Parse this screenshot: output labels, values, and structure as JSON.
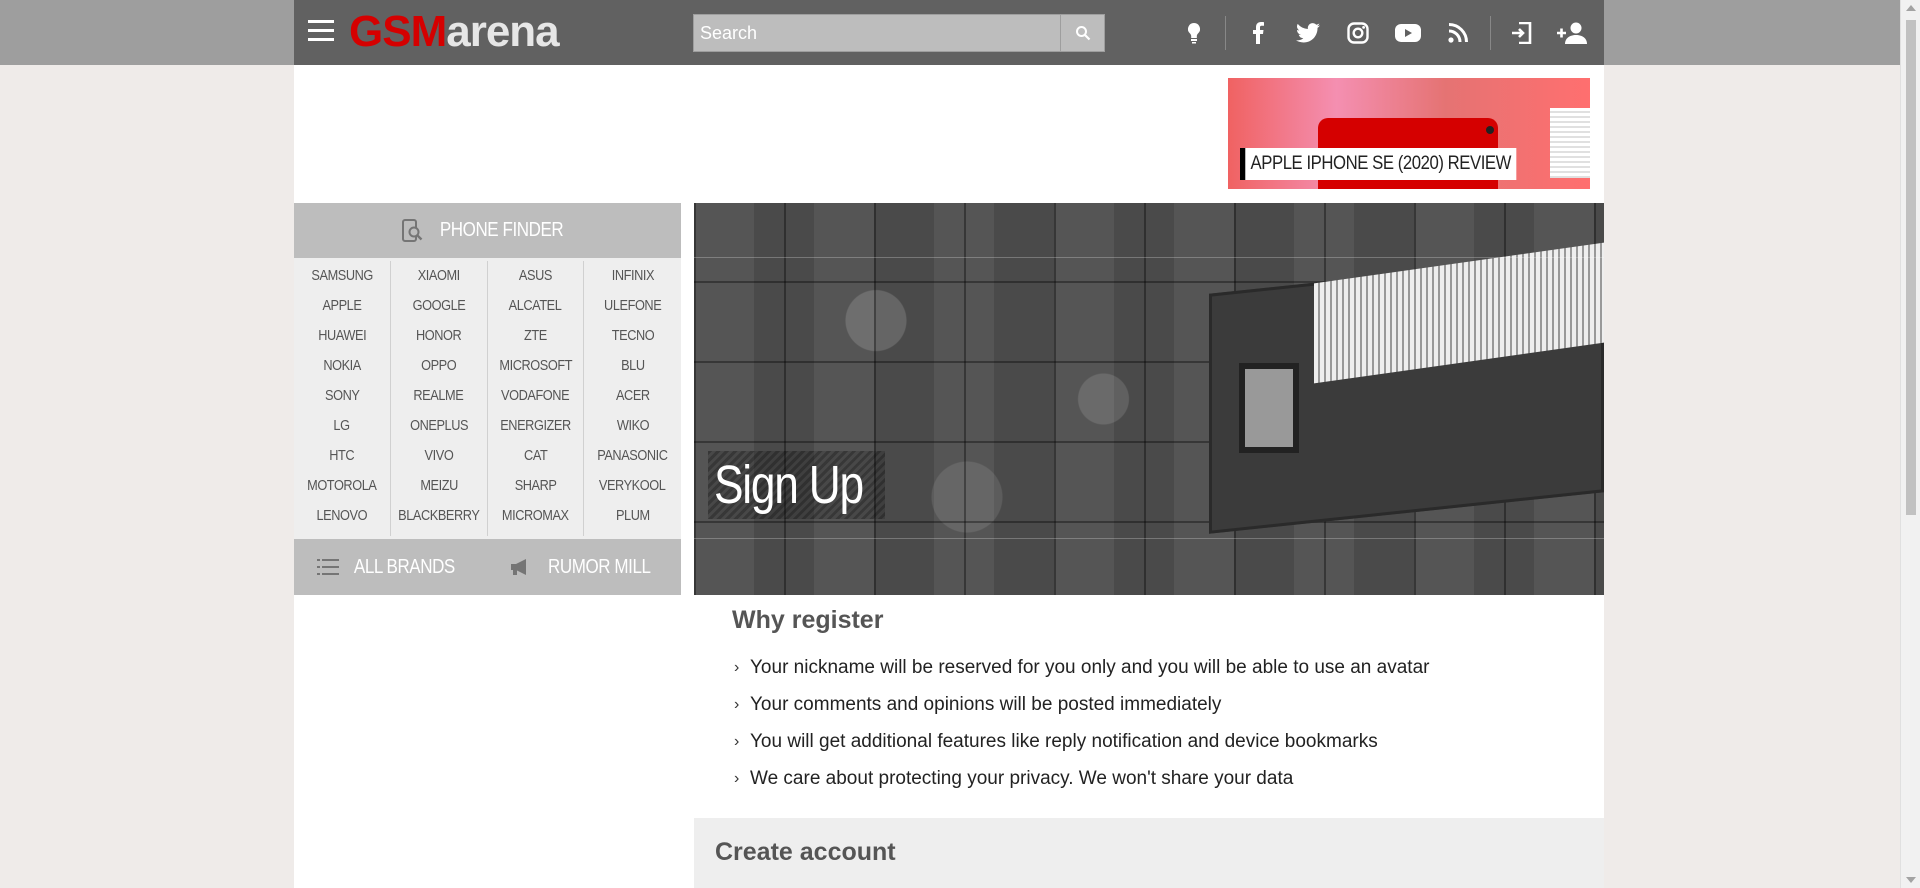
{
  "header": {
    "logo_red": "GSM",
    "logo_white": "arena",
    "search_placeholder": "Search",
    "icons": [
      "menu-icon",
      "search-icon",
      "lightbulb-icon",
      "facebook-icon",
      "twitter-icon",
      "instagram-icon",
      "youtube-icon",
      "rss-icon",
      "login-icon",
      "add-user-icon"
    ]
  },
  "ad": {
    "label": "APPLE IPHONE SE (2020) REVIEW"
  },
  "sidebar": {
    "phone_finder": "PHONE FINDER",
    "brand_columns": [
      [
        "SAMSUNG",
        "APPLE",
        "HUAWEI",
        "NOKIA",
        "SONY",
        "LG",
        "HTC",
        "MOTOROLA",
        "LENOVO"
      ],
      [
        "XIAOMI",
        "GOOGLE",
        "HONOR",
        "OPPO",
        "REALME",
        "ONEPLUS",
        "VIVO",
        "MEIZU",
        "BLACKBERRY"
      ],
      [
        "ASUS",
        "ALCATEL",
        "ZTE",
        "MICROSOFT",
        "VODAFONE",
        "ENERGIZER",
        "CAT",
        "SHARP",
        "MICROMAX"
      ],
      [
        "INFINIX",
        "ULEFONE",
        "TECNO",
        "BLU",
        "ACER",
        "WIKO",
        "PANASONIC",
        "VERYKOOL",
        "PLUM"
      ]
    ],
    "all_brands": "ALL BRANDS",
    "rumor_mill": "RUMOR MILL"
  },
  "hero": {
    "title": "Sign Up"
  },
  "why_register": {
    "heading": "Why register",
    "items": [
      "Your nickname will be reserved for you only and you will be able to use an avatar",
      "Your comments and opinions will be posted immediately",
      "You will get additional features like reply notification and device bookmarks",
      "We care about protecting your privacy. We won't share your data"
    ]
  },
  "create_account": {
    "heading": "Create account"
  },
  "colors": {
    "header_bg": "#616161",
    "brand_red": "#d50000",
    "sidebar_head": "#bdbdbd"
  }
}
